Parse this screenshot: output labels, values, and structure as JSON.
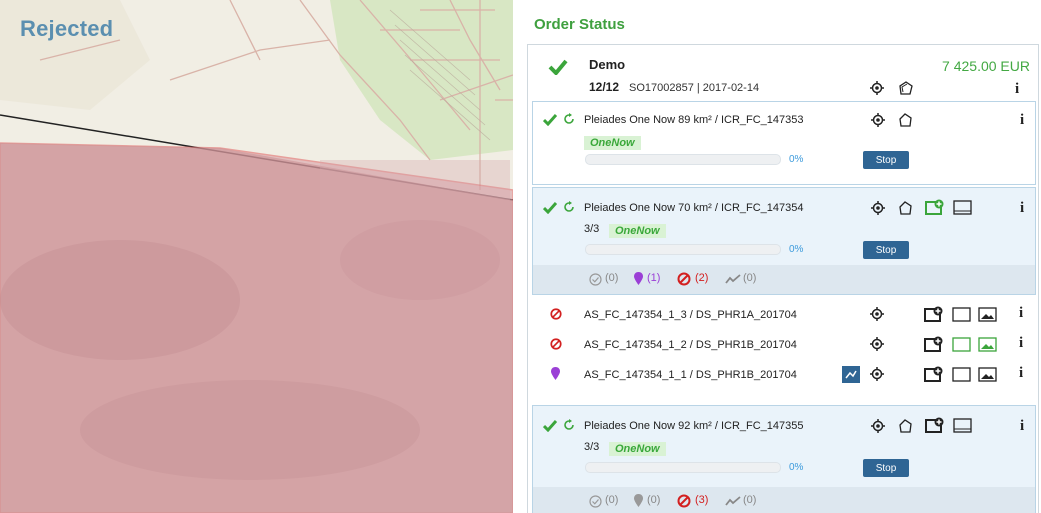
{
  "map": {
    "label": "Rejected"
  },
  "panel": {
    "title": "Order Status",
    "order": {
      "name": "Demo",
      "count": "12/12",
      "ref": "SO17002857 | 2017-02-14",
      "price": "7 425.00 EUR"
    },
    "items": [
      {
        "name": "Pleiades One Now 89 km² / ICR_FC_147353",
        "badge": "OneNow",
        "count": "",
        "percent": "0%",
        "stop_label": "Stop"
      },
      {
        "name": "Pleiades One Now 70 km² / ICR_FC_147354",
        "badge": "OneNow",
        "count": "3/3",
        "percent": "0%",
        "stop_label": "Stop",
        "stats": {
          "ok": "(0)",
          "pending": "(1)",
          "rejected": "(2)",
          "trend": "(0)"
        }
      },
      {
        "name": "Pleiades One Now 92 km² / ICR_FC_147355",
        "badge": "OneNow",
        "count": "3/3",
        "percent": "0%",
        "stop_label": "Stop",
        "stats": {
          "ok": "(0)",
          "pending": "(0)",
          "rejected": "(3)",
          "trend": "(0)"
        }
      }
    ],
    "acquisitions": [
      {
        "name": "AS_FC_147354_1_3 / DS_PHR1A_201704",
        "status": "rejected"
      },
      {
        "name": "AS_FC_147354_1_2 / DS_PHR1B_201704",
        "status": "rejected"
      },
      {
        "name": "AS_FC_147354_1_1 / DS_PHR1B_201704",
        "status": "pending"
      }
    ],
    "info_label": "i"
  },
  "colors": {
    "green": "#43a843",
    "blue": "#2f6594",
    "red": "#d32020",
    "purple": "#9b3fd6",
    "link": "#3d9bdc"
  }
}
